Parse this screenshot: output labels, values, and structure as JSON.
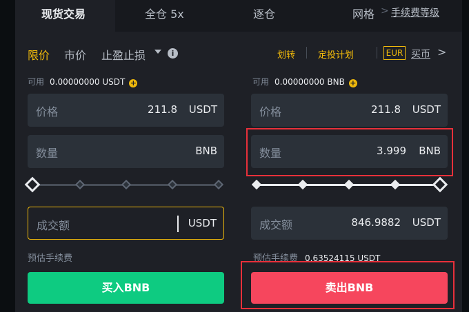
{
  "tabs": {
    "spot": "现货交易",
    "cross": "全仓 5x",
    "isolated": "逐仓",
    "grid": "网格",
    "fee_tier": "手续费等级"
  },
  "order_types": {
    "limit": "限价",
    "market": "市价",
    "stop_limit": "止盈止损",
    "info_glyph": "i"
  },
  "toolbar": {
    "transfer": "划转",
    "dca": "定投计划",
    "currency_badge": "EUR",
    "buy_crypto": "买币",
    "chevron": ">",
    "fee_chevron": ">"
  },
  "buy": {
    "available_label": "可用",
    "available_value": "0.00000000 USDT",
    "price_label": "价格",
    "price_value": "211.8",
    "price_unit": "USDT",
    "qty_label": "数量",
    "qty_value": "",
    "qty_unit": "BNB",
    "slider_percent": 0,
    "total_label": "成交额",
    "total_value": "",
    "total_unit": "USDT",
    "fee_label": "预估手续费",
    "fee_value": "",
    "button": "买入BNB"
  },
  "sell": {
    "available_label": "可用",
    "available_value": "0.00000000 BNB",
    "price_label": "价格",
    "price_value": "211.8",
    "price_unit": "USDT",
    "qty_label": "数量",
    "qty_value": "3.999",
    "qty_unit": "BNB",
    "slider_percent": 100,
    "total_label": "成交额",
    "total_value": "846.9882",
    "total_unit": "USDT",
    "fee_label": "预估手续费",
    "fee_value": "0.63524115 USDT",
    "button": "卖出BNB"
  },
  "colors": {
    "accent": "#f0b90b",
    "buy": "#0ecb81",
    "sell": "#f6465d",
    "highlight": "#e8303a"
  },
  "icons": {
    "plus": "+"
  }
}
